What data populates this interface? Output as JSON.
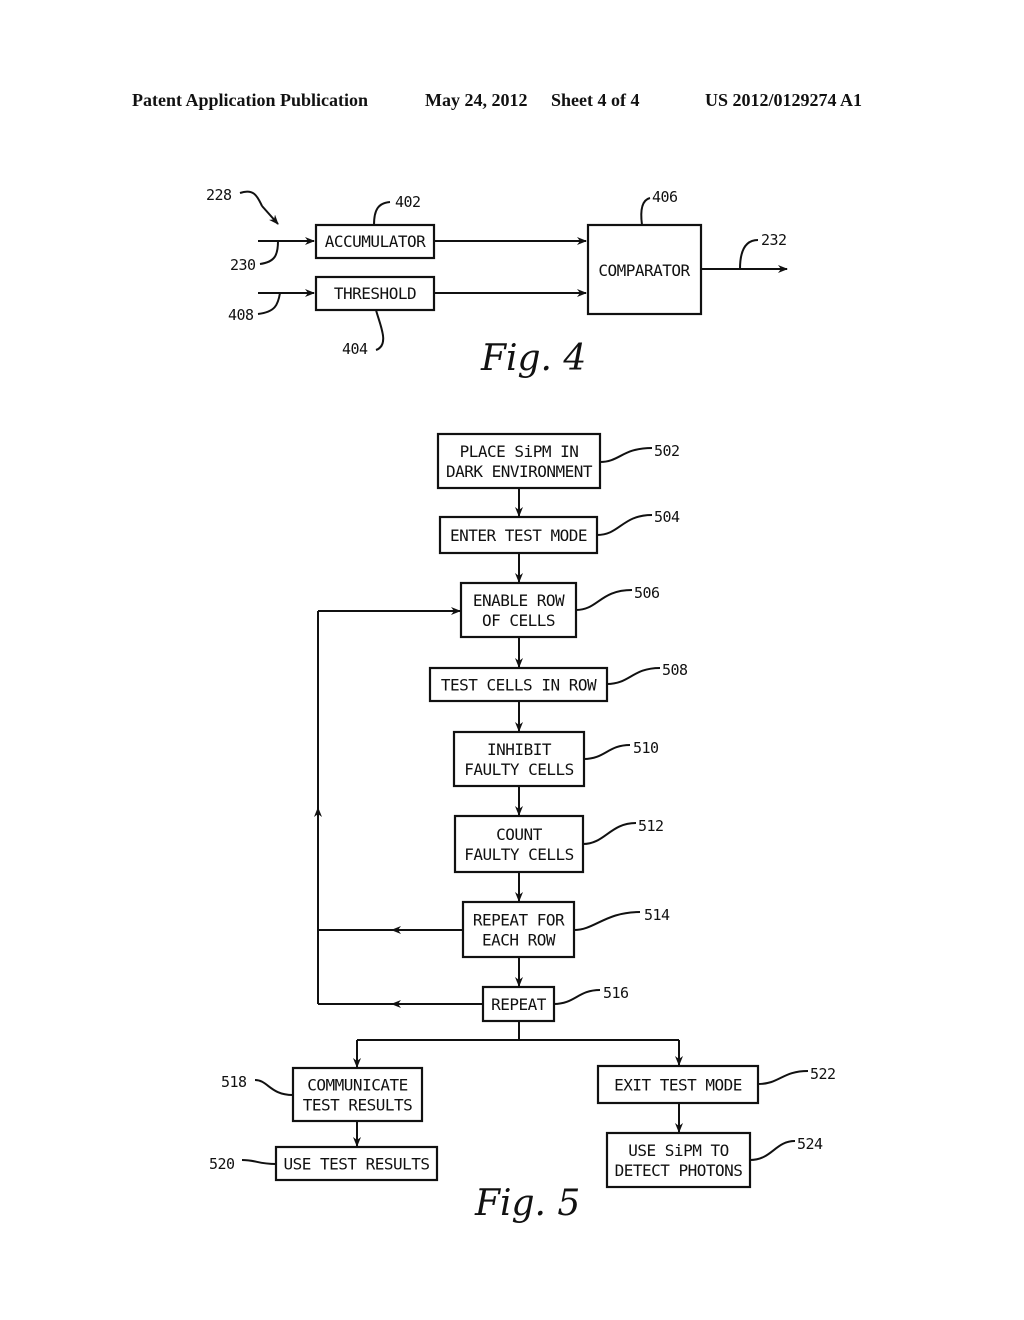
{
  "header": {
    "publication": "Patent Application Publication",
    "date": "May 24, 2012",
    "sheet": "Sheet 4 of 4",
    "number": "US 2012/0129274 A1"
  },
  "fig4": {
    "caption": "Fig. 4",
    "refs": {
      "system": "228",
      "input_accumulator": "230",
      "input_threshold": "408",
      "output": "232"
    },
    "blocks": [
      {
        "id": "402",
        "label": "ACCUMULATOR"
      },
      {
        "id": "404",
        "label": "THRESHOLD"
      },
      {
        "id": "406",
        "label": "COMPARATOR"
      }
    ]
  },
  "fig5": {
    "caption": "Fig. 5",
    "steps": [
      {
        "id": "502",
        "lines": [
          "PLACE SiPM IN",
          "DARK ENVIRONMENT"
        ]
      },
      {
        "id": "504",
        "lines": [
          "ENTER TEST MODE"
        ]
      },
      {
        "id": "506",
        "lines": [
          "ENABLE ROW",
          "OF CELLS"
        ]
      },
      {
        "id": "508",
        "lines": [
          "TEST CELLS IN ROW"
        ]
      },
      {
        "id": "510",
        "lines": [
          "INHIBIT",
          "FAULTY CELLS"
        ]
      },
      {
        "id": "512",
        "lines": [
          "COUNT",
          "FAULTY CELLS"
        ]
      },
      {
        "id": "514",
        "lines": [
          "REPEAT FOR",
          "EACH ROW"
        ]
      },
      {
        "id": "516",
        "lines": [
          "REPEAT"
        ]
      },
      {
        "id": "518",
        "lines": [
          "COMMUNICATE",
          "TEST RESULTS"
        ]
      },
      {
        "id": "520",
        "lines": [
          "USE TEST RESULTS"
        ]
      },
      {
        "id": "522",
        "lines": [
          "EXIT TEST MODE"
        ]
      },
      {
        "id": "524",
        "lines": [
          "USE SiPM TO",
          "DETECT PHOTONS"
        ]
      }
    ]
  }
}
